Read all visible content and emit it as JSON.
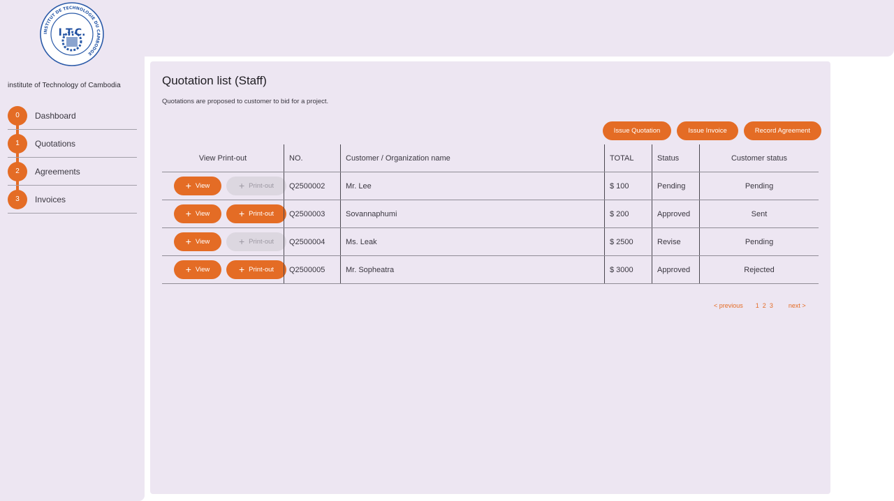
{
  "sidebar": {
    "logo": {
      "text": "I.T.C.",
      "ring_text": "INSTITUT DE TECHNOLOGIE DU CAMBODGE"
    },
    "org_name": "institute of Technology of Cambodia",
    "items": [
      {
        "step": "0",
        "label": "Dashboard"
      },
      {
        "step": "1",
        "label": "Quotations"
      },
      {
        "step": "2",
        "label": "Agreements"
      },
      {
        "step": "3",
        "label": "Invoices"
      }
    ]
  },
  "page": {
    "title": "Quotation list (Staff)",
    "subtitle": "Quotations are proposed to customer to bid for a project."
  },
  "actions": {
    "issue_quotation": "Issue Quotation",
    "issue_invoice": "Issue Invoice",
    "record_agreement": "Record Agreement"
  },
  "table": {
    "headers": {
      "view_printout": "View Print-out",
      "no": "NO.",
      "customer": "Customer / Organization name",
      "total": "TOTAL",
      "status": "Status",
      "customer_status": "Customer status"
    },
    "buttons": {
      "view": "View",
      "printout": "Print-out"
    },
    "rows": [
      {
        "no": "Q2500002",
        "customer": "Mr. Lee",
        "total": "$ 100",
        "status": "Pending",
        "customer_status": "Pending",
        "printout_enabled": false
      },
      {
        "no": "Q2500003",
        "customer": "Sovannaphumi",
        "total": "$ 200",
        "status": "Approved",
        "customer_status": "Sent",
        "printout_enabled": true
      },
      {
        "no": "Q2500004",
        "customer": "Ms. Leak",
        "total": "$ 2500",
        "status": "Revise",
        "customer_status": "Pending",
        "printout_enabled": false
      },
      {
        "no": "Q2500005",
        "customer": "Mr. Sopheatra",
        "total": "$ 3000",
        "status": "Approved",
        "customer_status": "Rejected",
        "printout_enabled": true
      }
    ]
  },
  "pagination": {
    "previous": "< previous",
    "pages": [
      "1",
      "2",
      "3"
    ],
    "next": "next >"
  },
  "colors": {
    "accent": "#e46c25",
    "panel": "#ede6f2",
    "disabled": "#dcd7e0"
  }
}
